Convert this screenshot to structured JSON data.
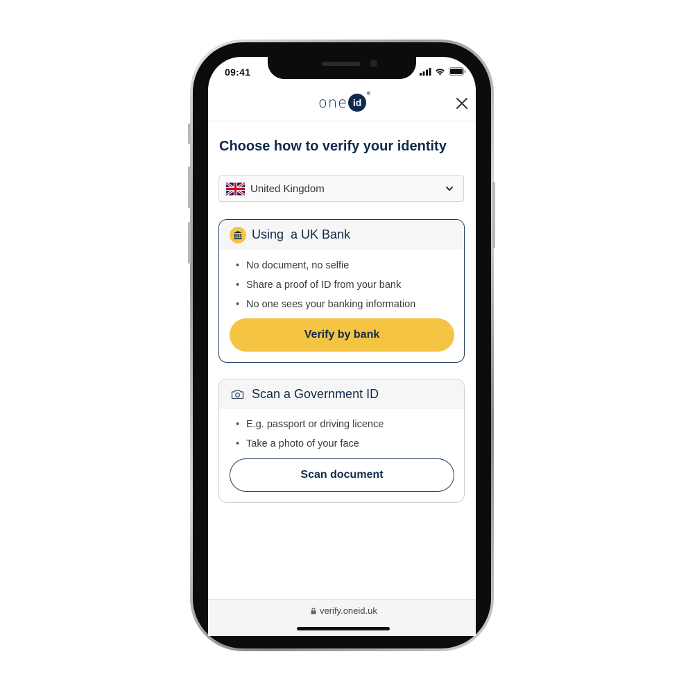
{
  "status_bar": {
    "time": "09:41"
  },
  "header": {
    "logo_text": "one",
    "logo_badge": "id",
    "logo_reg": "®"
  },
  "page": {
    "title": "Choose how to verify your identity"
  },
  "country_select": {
    "selected": "United Kingdom"
  },
  "options": [
    {
      "title": "Using  a UK Bank",
      "bullets": [
        "No document, no selfie",
        "Share a proof of ID from your bank",
        "No one sees your banking information"
      ],
      "button_label": "Verify by bank"
    },
    {
      "title": "Scan a Government ID",
      "bullets": [
        "E.g. passport or driving licence",
        "Take a photo of your face"
      ],
      "button_label": "Scan document"
    }
  ],
  "footer": {
    "url": "verify.oneid.uk"
  },
  "colors": {
    "brand_navy": "#0f2a4a",
    "accent_yellow": "#f5c443"
  },
  "icons": [
    "signal-icon",
    "wifi-icon",
    "battery-icon",
    "close-icon",
    "uk-flag-icon",
    "chevron-down-icon",
    "bank-icon",
    "camera-icon",
    "lock-icon"
  ]
}
